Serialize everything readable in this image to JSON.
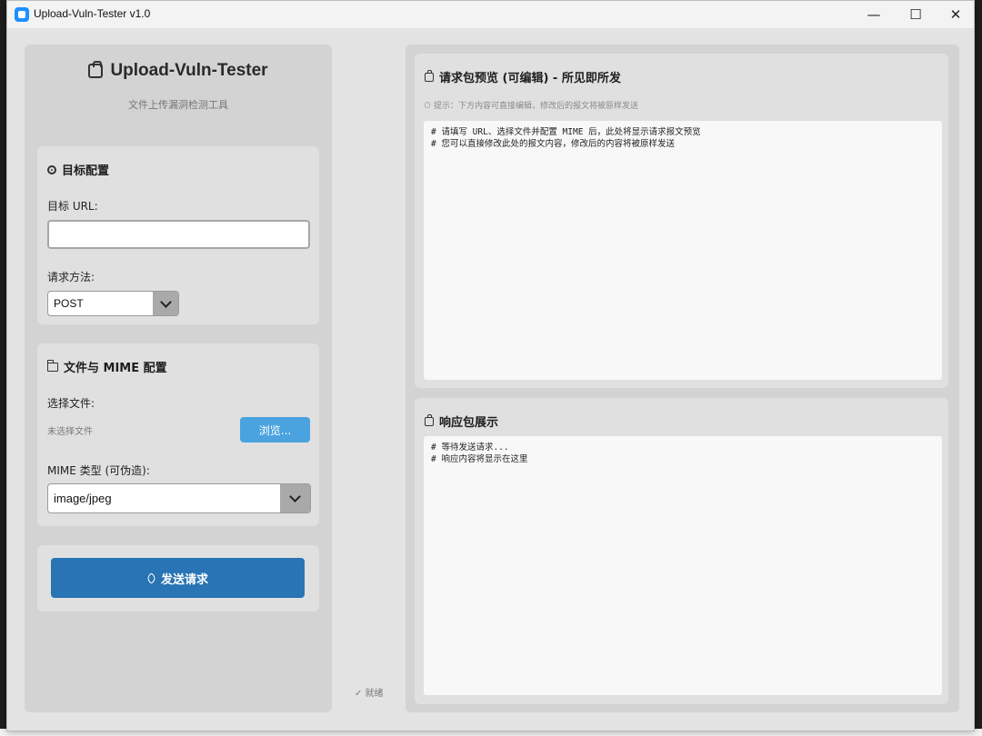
{
  "window": {
    "title": "Upload-Vuln-Tester v1.0",
    "controls": [
      "—",
      "☐",
      "✕"
    ]
  },
  "app": {
    "title": "Upload-Vuln-Tester",
    "subtitle": "文件上传漏洞检测工具"
  },
  "target_card": {
    "title": "目标配置",
    "url_label": "目标 URL:",
    "url_value": "",
    "method_label": "请求方法:",
    "method_selected": "POST"
  },
  "file_card": {
    "title": "文件与 MIME 配置",
    "file_label": "选择文件:",
    "file_status": "未选择文件",
    "browse_label": "浏览...",
    "mime_label": "MIME 类型 (可伪造):",
    "mime_selected": "image/jpeg"
  },
  "send": {
    "label": "发送请求"
  },
  "status": {
    "text": "✓ 就绪"
  },
  "request_panel": {
    "title": "请求包预览 (可编辑) - 所见即所发",
    "hint": "提示：下方内容可直接编辑，修改后的报文将被原样发送",
    "content": "# 请填写 URL、选择文件并配置 MIME 后，此处将显示请求报文预览\n# 您可以直接修改此处的报文内容，修改后的内容将被原样发送"
  },
  "response_panel": {
    "title": "响应包展示",
    "content": "# 等待发送请求...\n# 响应内容将显示在这里"
  },
  "colors": {
    "send_button": "#2874b4",
    "browse_button": "#4aa3df",
    "panel_bg": "#d3d3d3",
    "card_bg": "#e0e0e0"
  }
}
